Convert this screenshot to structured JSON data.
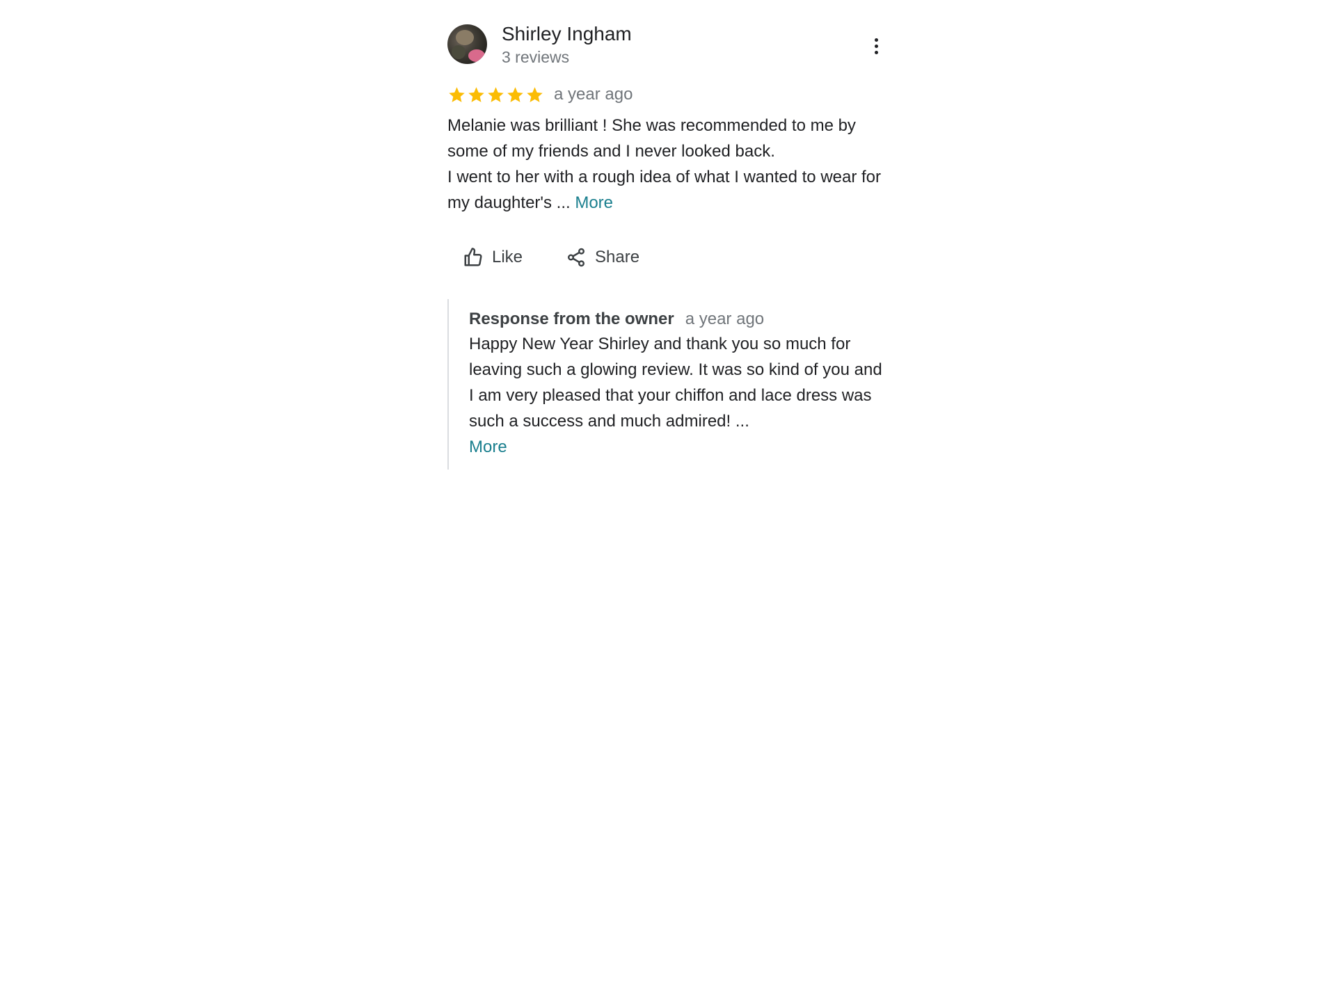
{
  "reviewer": {
    "name": "Shirley Ingham",
    "review_count": "3 reviews"
  },
  "review": {
    "rating": 5,
    "max_rating": 5,
    "date": "a year ago",
    "text_line1": "Melanie was brilliant ! She was recommended to me by some of my friends and I never looked back.",
    "text_line2": "I went to her with a rough idea of what I wanted to wear for my daughter's ...",
    "more_label": "More"
  },
  "actions": {
    "like_label": "Like",
    "share_label": "Share"
  },
  "owner_response": {
    "title": "Response from the owner",
    "date": "a year ago",
    "text": "Happy New Year Shirley and thank you so much for leaving such a glowing review.  It was so kind of you and I am very pleased that your chiffon and lace dress was such a success and much admired! ...",
    "more_label": "More"
  },
  "colors": {
    "star": "#fbbc04",
    "link": "#1a7f8e",
    "secondary_text": "#70757a"
  },
  "icons": [
    "avatar-image",
    "more-vert-icon",
    "star-icon",
    "thumb-up-icon",
    "share-icon"
  ]
}
